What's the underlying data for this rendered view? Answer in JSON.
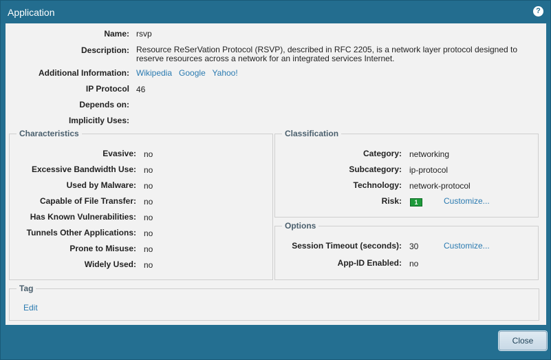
{
  "window": {
    "title": "Application"
  },
  "general": {
    "name_label": "Name:",
    "name_value": "rsvp",
    "description_label": "Description:",
    "description_value": "Resource ReSerVation Protocol (RSVP), described in RFC 2205, is a network layer protocol designed to reserve resources across a network for an integrated services Internet.",
    "additional_info_label": "Additional Information:",
    "links": [
      "Wikipedia",
      "Google",
      "Yahoo!"
    ],
    "ip_protocol_label": "IP Protocol",
    "ip_protocol_value": "46",
    "depends_on_label": "Depends on:",
    "implicitly_uses_label": "Implicitly Uses:"
  },
  "characteristics": {
    "title": "Characteristics",
    "rows": [
      {
        "label": "Evasive:",
        "value": "no"
      },
      {
        "label": "Excessive Bandwidth Use:",
        "value": "no"
      },
      {
        "label": "Used by Malware:",
        "value": "no"
      },
      {
        "label": "Capable of File Transfer:",
        "value": "no"
      },
      {
        "label": "Has Known Vulnerabilities:",
        "value": "no"
      },
      {
        "label": "Tunnels Other Applications:",
        "value": "no"
      },
      {
        "label": "Prone to Misuse:",
        "value": "no"
      },
      {
        "label": "Widely Used:",
        "value": "no"
      }
    ]
  },
  "classification": {
    "title": "Classification",
    "category_label": "Category:",
    "category_value": "networking",
    "subcategory_label": "Subcategory:",
    "subcategory_value": "ip-protocol",
    "technology_label": "Technology:",
    "technology_value": "network-protocol",
    "risk_label": "Risk:",
    "risk_value": "1",
    "risk_color": "#1e9a3a",
    "customize_label": "Customize..."
  },
  "options": {
    "title": "Options",
    "session_timeout_label": "Session Timeout (seconds):",
    "session_timeout_value": "30",
    "customize_label": "Customize...",
    "appid_label": "App-ID Enabled:",
    "appid_value": "no"
  },
  "tag": {
    "title": "Tag",
    "edit_label": "Edit"
  },
  "footer": {
    "close_label": "Close"
  }
}
